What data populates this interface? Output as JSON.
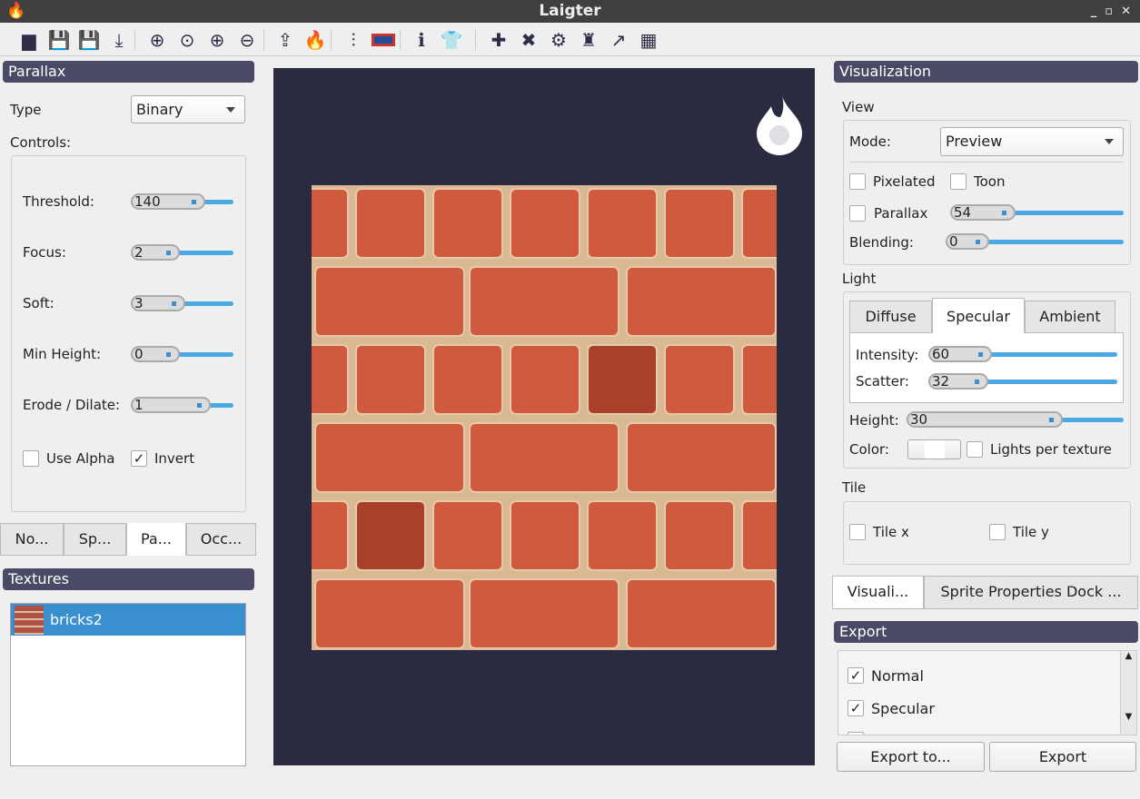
{
  "app": {
    "title": "Laigter"
  },
  "toolbar": {
    "icons": [
      "open-folder-icon",
      "save-icon",
      "save-as-icon",
      "import-icon",
      "zoom-fit-icon",
      "zoom-100-icon",
      "zoom-in-icon",
      "zoom-out-icon",
      "export-icon",
      "add-light-icon",
      "settings-sliders-icon",
      "language-flag-icon",
      "info-icon",
      "tshirt-icon",
      "plugin-add-icon",
      "plugin-remove-icon",
      "plugin-settings-icon",
      "brush-icon",
      "curve-icon",
      "tile-grid-icon"
    ]
  },
  "parallax": {
    "title": "Parallax",
    "type_label": "Type",
    "type_value": "Binary",
    "controls_label": "Controls:",
    "sliders": [
      {
        "label": "Threshold:",
        "value": "140",
        "fraction": 0.55
      },
      {
        "label": "Focus:",
        "value": "2",
        "fraction": 0.3
      },
      {
        "label": "Soft:",
        "value": "3",
        "fraction": 0.35
      },
      {
        "label": "Min Height:",
        "value": "0",
        "fraction": 0.3
      },
      {
        "label": "Erode / Dilate:",
        "value": "1",
        "fraction": 0.6
      }
    ],
    "use_alpha": {
      "label": "Use Alpha",
      "checked": false
    },
    "invert": {
      "label": "Invert",
      "checked": true
    }
  },
  "left_tabs": [
    {
      "label": "No..."
    },
    {
      "label": "Sp..."
    },
    {
      "label": "Pa...",
      "active": true
    },
    {
      "label": "Occ..."
    }
  ],
  "textures": {
    "title": "Textures",
    "items": [
      {
        "name": "bricks2",
        "selected": true
      }
    ]
  },
  "visualization": {
    "title": "Visualization",
    "view_label": "View",
    "mode_label": "Mode:",
    "mode_value": "Preview",
    "pixelated": {
      "label": "Pixelated",
      "checked": false
    },
    "toon": {
      "label": "Toon",
      "checked": false
    },
    "parallax": {
      "label": "Parallax",
      "checked": false,
      "value": "54",
      "fraction": 0.3
    },
    "blending": {
      "label": "Blending:",
      "value": "0",
      "fraction": 0.2
    },
    "light_label": "Light",
    "light_tabs": [
      {
        "label": "Diffuse"
      },
      {
        "label": "Specular",
        "active": true
      },
      {
        "label": "Ambient"
      }
    ],
    "intensity": {
      "label": "Intensity:",
      "value": "60",
      "fraction": 0.33
    },
    "scatter": {
      "label": "Scatter:",
      "value": "32",
      "fraction": 0.31
    },
    "height": {
      "label": "Height:",
      "value": "30",
      "fraction": 0.7
    },
    "color_label": "Color:",
    "color_value": "#ffffff",
    "lights_per_texture": {
      "label": "Lights per texture",
      "checked": false
    },
    "tile_label": "Tile",
    "tile_x": {
      "label": "Tile x",
      "checked": false
    },
    "tile_y": {
      "label": "Tile y",
      "checked": false
    }
  },
  "right_tabs": [
    {
      "label": "Visuali...",
      "active": true
    },
    {
      "label": "Sprite Properties Dock ..."
    }
  ],
  "export": {
    "title": "Export",
    "items": [
      {
        "label": "Normal",
        "checked": true
      },
      {
        "label": "Specular",
        "checked": true
      }
    ],
    "export_to_label": "Export to...",
    "export_label": "Export"
  },
  "colors": {
    "canvas": "#2a2a40",
    "accent": "#4aa8e6",
    "selection": "#3a8fd0",
    "dock_header": "#4a4a66"
  }
}
